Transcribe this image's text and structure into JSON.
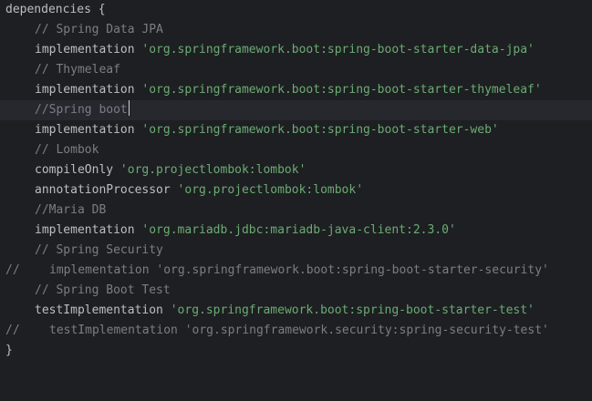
{
  "editor": {
    "lines": {
      "l0": {
        "text": "dependencies {"
      },
      "l1": {
        "comment": "// Spring Data JPA"
      },
      "l2": {
        "keyword": "implementation",
        "string": "'org.springframework.boot:spring-boot-starter-data-jpa'"
      },
      "l3": {
        "comment": "// Thymeleaf"
      },
      "l4": {
        "keyword": "implementation",
        "string": "'org.springframework.boot:spring-boot-starter-thymeleaf'"
      },
      "l5": {
        "comment": "//Spring boot"
      },
      "l6": {
        "keyword": "implementation",
        "string": "'org.springframework.boot:spring-boot-starter-web'"
      },
      "l7": {
        "comment": "// Lombok"
      },
      "l8": {
        "keyword": "compileOnly",
        "string": "'org.projectlombok:lombok'"
      },
      "l9": {
        "keyword": "annotationProcessor",
        "string": "'org.projectlombok:lombok'"
      },
      "l10": {
        "comment": "//Maria DB"
      },
      "l11": {
        "keyword": "implementation",
        "string": "'org.mariadb.jdbc:mariadb-java-client:2.3.0'"
      },
      "l12": {
        "comment": "// Spring Security"
      },
      "l13": {
        "prefix": "//",
        "code": "implementation 'org.springframework.boot:spring-boot-starter-security'"
      },
      "l14": {
        "comment": "// Spring Boot Test"
      },
      "l15": {
        "keyword": "testImplementation",
        "string": "'org.springframework.boot:spring-boot-starter-test'"
      },
      "l16": {
        "prefix": "//",
        "code": "testImplementation 'org.springframework.security:spring-security-test'"
      },
      "l17": {
        "text": "}"
      }
    }
  },
  "colors": {
    "background": "#1e1f22",
    "current_line": "#26282e",
    "default_text": "#bcbec4",
    "string": "#6aab73",
    "comment": "#7a7e85"
  }
}
